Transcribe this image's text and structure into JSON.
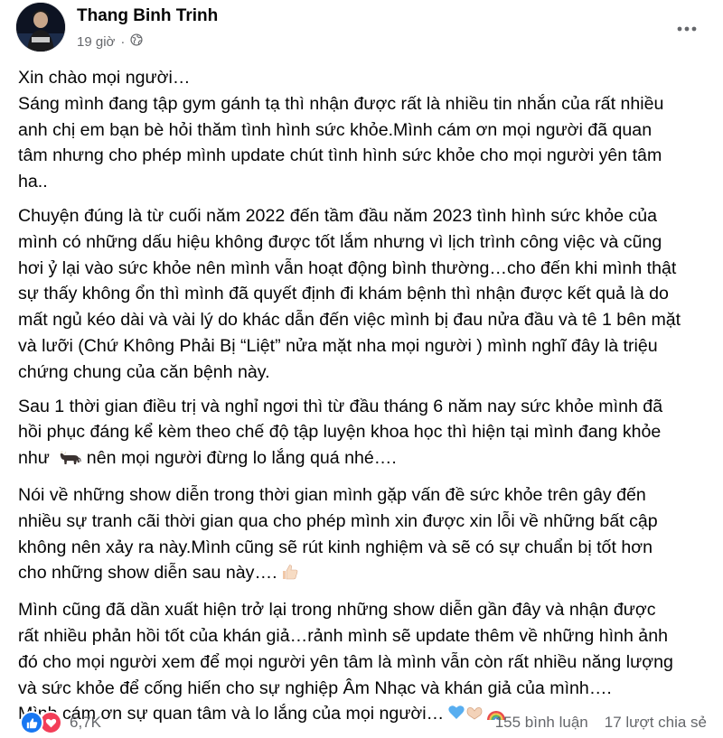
{
  "post": {
    "author": "Thang Binh Trinh",
    "time": "19 giờ",
    "separator": "·",
    "privacy_icon": "globe-icon",
    "menu_icon": "more-options-icon"
  },
  "paragraphs": [
    [
      "Xin chào mọi người…",
      "Sáng mình đang tập gym gánh tạ thì nhận được rất là nhiều tin nhắn của rất nhiều",
      "anh chị em bạn bè hỏi thăm tình hình sức khỏe.Mình cám ơn mọi người đã quan",
      "tâm nhưng cho phép mình update chút tình hình sức khỏe cho mọi người yên tâm",
      "ha.."
    ],
    [
      "Chuyện đúng là từ cuối năm 2022 đến tầm đầu năm 2023 tình hình sức khỏe của",
      "mình có những dấu hiệu không được tốt lắm nhưng vì lịch trình công việc và cũng",
      "hơi ỷ lại vào sức khỏe nên mình vẫn hoạt động bình thường…cho đến khi mình thật",
      "sự thấy không ổn thì mình đã quyết định đi khám bệnh thì nhận được kết quả là do",
      "mất ngủ kéo dài và vài lý do khác dẫn đến việc mình bị đau nửa đầu và tê 1 bên mặt",
      "và lưỡi (Chứ Không Phải Bị “Liệt” nửa mặt nha mọi người ) mình nghĩ đây là triệu",
      "chứng chung của căn bệnh này."
    ],
    [
      "Sau 1 thời gian điều trị và nghỉ ngơi thì từ đầu tháng 6 năm nay sức khỏe mình đã",
      "hồi phục đáng kể kèm theo chế độ tập luyện khoa học thì hiện tại mình đang khỏe",
      {
        "before": "như ",
        "emoji": "ox-emoji",
        "after": " nên mọi người đừng lo lắng quá nhé…."
      }
    ],
    [
      "Nói về những show diễn trong thời gian mình gặp vấn đề sức khỏe trên gây đến",
      "nhiều sự tranh cãi thời gian qua cho phép mình xin được xin lỗi về những bất cập",
      "không nên xảy ra này.Mình cũng sẽ rút kinh nghiệm và sẽ có sự chuẩn bị tốt hơn",
      {
        "before": "cho những show diễn sau này….",
        "emoji": "thumbs-up-emoji",
        "after": ""
      }
    ],
    [
      "Mình cũng đã dần xuất hiện trở lại trong những show diễn gần đây và nhận được",
      "rất nhiều phản hồi tốt của khán giả…rảnh mình sẽ update thêm về những hình ảnh",
      "đó cho mọi người xem để mọi người yên tâm là mình vẫn còn rất nhiều năng lượng",
      "và sức khỏe để cống hiến cho sự nghiệp Âm Nhạc và khán giả của mình….",
      {
        "before": "Mình cám ơn sự quan tâm và lo lắng của mọi người…",
        "emoji": "blue-heart-heart-hands-rainbow-emoji",
        "after": ""
      }
    ]
  ],
  "footer": {
    "reactions_count": "6,7K",
    "reaction_icons": [
      "like-icon",
      "love-icon"
    ],
    "comments": "155 bình luận",
    "shares": "17 lượt chia sẻ"
  },
  "colors": {
    "text": "#050505",
    "secondary": "#65676b",
    "like": "#1877f2",
    "love": "#f33e58"
  }
}
